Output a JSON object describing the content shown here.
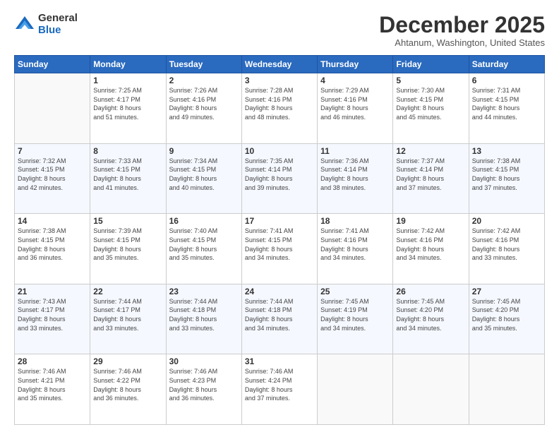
{
  "header": {
    "logo": {
      "general": "General",
      "blue": "Blue"
    },
    "title": "December 2025",
    "location": "Ahtanum, Washington, United States"
  },
  "days_of_week": [
    "Sunday",
    "Monday",
    "Tuesday",
    "Wednesday",
    "Thursday",
    "Friday",
    "Saturday"
  ],
  "weeks": [
    [
      {
        "day": "",
        "info": ""
      },
      {
        "day": "1",
        "info": "Sunrise: 7:25 AM\nSunset: 4:17 PM\nDaylight: 8 hours\nand 51 minutes."
      },
      {
        "day": "2",
        "info": "Sunrise: 7:26 AM\nSunset: 4:16 PM\nDaylight: 8 hours\nand 49 minutes."
      },
      {
        "day": "3",
        "info": "Sunrise: 7:28 AM\nSunset: 4:16 PM\nDaylight: 8 hours\nand 48 minutes."
      },
      {
        "day": "4",
        "info": "Sunrise: 7:29 AM\nSunset: 4:16 PM\nDaylight: 8 hours\nand 46 minutes."
      },
      {
        "day": "5",
        "info": "Sunrise: 7:30 AM\nSunset: 4:15 PM\nDaylight: 8 hours\nand 45 minutes."
      },
      {
        "day": "6",
        "info": "Sunrise: 7:31 AM\nSunset: 4:15 PM\nDaylight: 8 hours\nand 44 minutes."
      }
    ],
    [
      {
        "day": "7",
        "info": "Sunrise: 7:32 AM\nSunset: 4:15 PM\nDaylight: 8 hours\nand 42 minutes."
      },
      {
        "day": "8",
        "info": "Sunrise: 7:33 AM\nSunset: 4:15 PM\nDaylight: 8 hours\nand 41 minutes."
      },
      {
        "day": "9",
        "info": "Sunrise: 7:34 AM\nSunset: 4:15 PM\nDaylight: 8 hours\nand 40 minutes."
      },
      {
        "day": "10",
        "info": "Sunrise: 7:35 AM\nSunset: 4:14 PM\nDaylight: 8 hours\nand 39 minutes."
      },
      {
        "day": "11",
        "info": "Sunrise: 7:36 AM\nSunset: 4:14 PM\nDaylight: 8 hours\nand 38 minutes."
      },
      {
        "day": "12",
        "info": "Sunrise: 7:37 AM\nSunset: 4:14 PM\nDaylight: 8 hours\nand 37 minutes."
      },
      {
        "day": "13",
        "info": "Sunrise: 7:38 AM\nSunset: 4:15 PM\nDaylight: 8 hours\nand 37 minutes."
      }
    ],
    [
      {
        "day": "14",
        "info": "Sunrise: 7:38 AM\nSunset: 4:15 PM\nDaylight: 8 hours\nand 36 minutes."
      },
      {
        "day": "15",
        "info": "Sunrise: 7:39 AM\nSunset: 4:15 PM\nDaylight: 8 hours\nand 35 minutes."
      },
      {
        "day": "16",
        "info": "Sunrise: 7:40 AM\nSunset: 4:15 PM\nDaylight: 8 hours\nand 35 minutes."
      },
      {
        "day": "17",
        "info": "Sunrise: 7:41 AM\nSunset: 4:15 PM\nDaylight: 8 hours\nand 34 minutes."
      },
      {
        "day": "18",
        "info": "Sunrise: 7:41 AM\nSunset: 4:16 PM\nDaylight: 8 hours\nand 34 minutes."
      },
      {
        "day": "19",
        "info": "Sunrise: 7:42 AM\nSunset: 4:16 PM\nDaylight: 8 hours\nand 34 minutes."
      },
      {
        "day": "20",
        "info": "Sunrise: 7:42 AM\nSunset: 4:16 PM\nDaylight: 8 hours\nand 33 minutes."
      }
    ],
    [
      {
        "day": "21",
        "info": "Sunrise: 7:43 AM\nSunset: 4:17 PM\nDaylight: 8 hours\nand 33 minutes."
      },
      {
        "day": "22",
        "info": "Sunrise: 7:44 AM\nSunset: 4:17 PM\nDaylight: 8 hours\nand 33 minutes."
      },
      {
        "day": "23",
        "info": "Sunrise: 7:44 AM\nSunset: 4:18 PM\nDaylight: 8 hours\nand 33 minutes."
      },
      {
        "day": "24",
        "info": "Sunrise: 7:44 AM\nSunset: 4:18 PM\nDaylight: 8 hours\nand 34 minutes."
      },
      {
        "day": "25",
        "info": "Sunrise: 7:45 AM\nSunset: 4:19 PM\nDaylight: 8 hours\nand 34 minutes."
      },
      {
        "day": "26",
        "info": "Sunrise: 7:45 AM\nSunset: 4:20 PM\nDaylight: 8 hours\nand 34 minutes."
      },
      {
        "day": "27",
        "info": "Sunrise: 7:45 AM\nSunset: 4:20 PM\nDaylight: 8 hours\nand 35 minutes."
      }
    ],
    [
      {
        "day": "28",
        "info": "Sunrise: 7:46 AM\nSunset: 4:21 PM\nDaylight: 8 hours\nand 35 minutes."
      },
      {
        "day": "29",
        "info": "Sunrise: 7:46 AM\nSunset: 4:22 PM\nDaylight: 8 hours\nand 36 minutes."
      },
      {
        "day": "30",
        "info": "Sunrise: 7:46 AM\nSunset: 4:23 PM\nDaylight: 8 hours\nand 36 minutes."
      },
      {
        "day": "31",
        "info": "Sunrise: 7:46 AM\nSunset: 4:24 PM\nDaylight: 8 hours\nand 37 minutes."
      },
      {
        "day": "",
        "info": ""
      },
      {
        "day": "",
        "info": ""
      },
      {
        "day": "",
        "info": ""
      }
    ]
  ]
}
